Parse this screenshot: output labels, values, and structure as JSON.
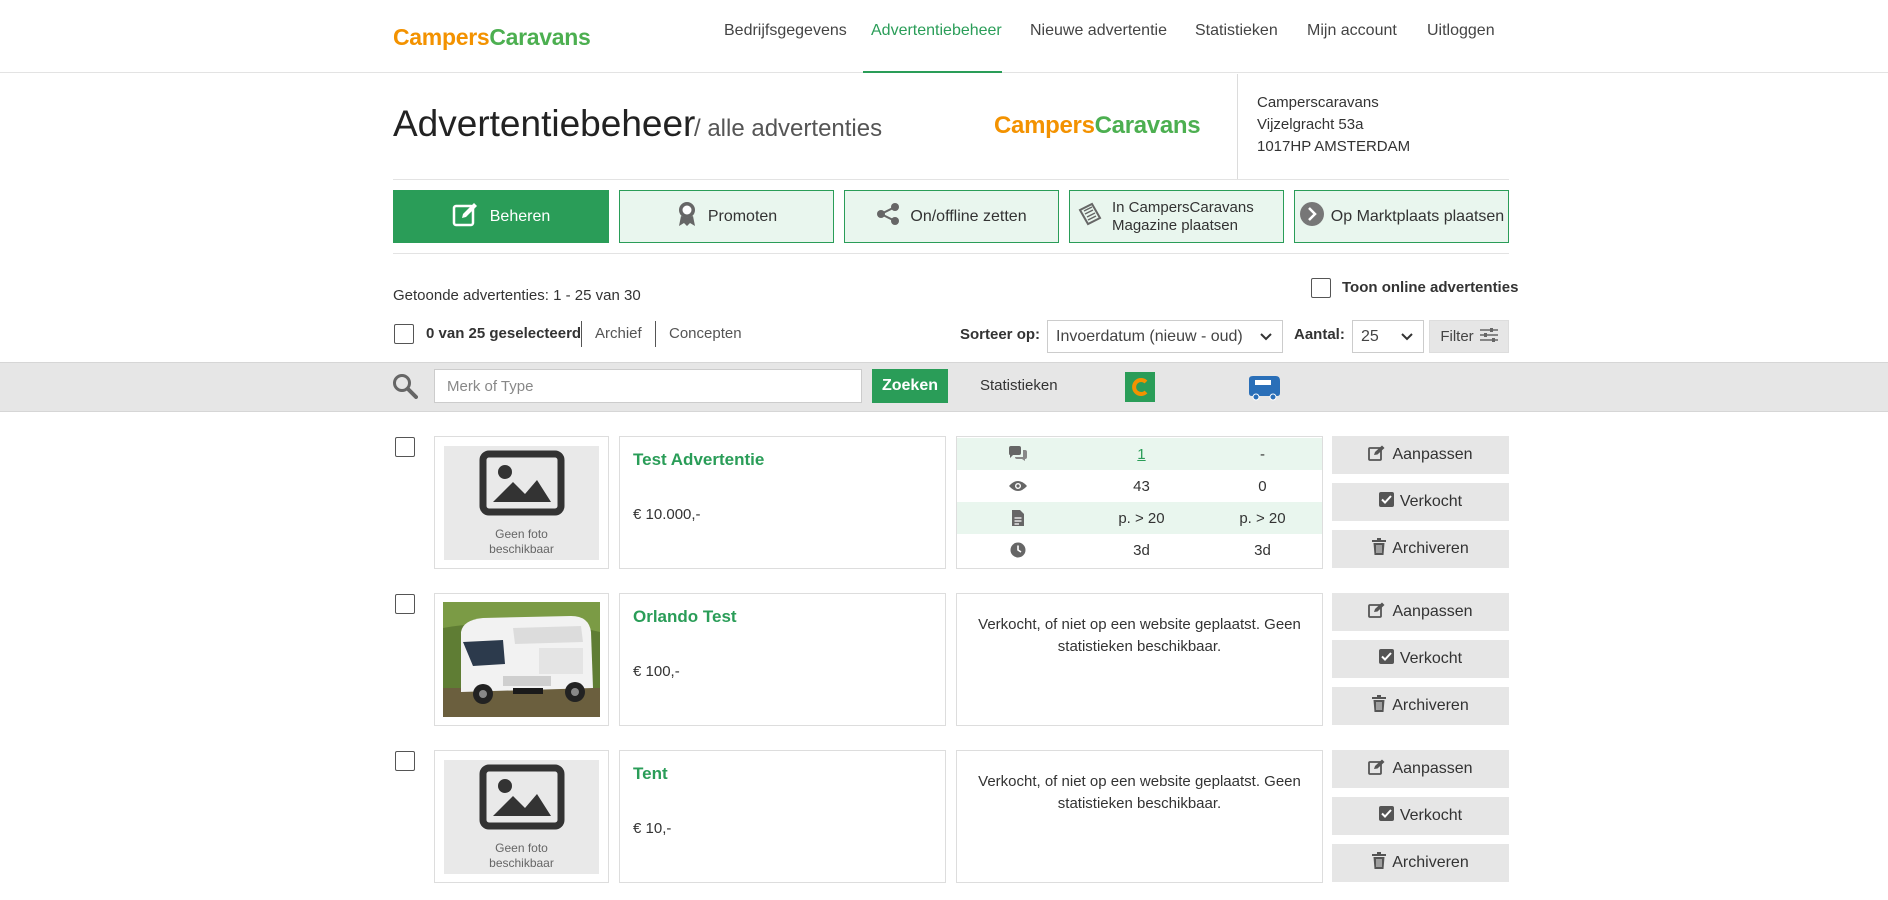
{
  "brand": {
    "part1": "Campers",
    "part2": "Caravans"
  },
  "nav": {
    "items": [
      {
        "label": "Bedrijfsgegevens"
      },
      {
        "label": "Advertentiebeheer"
      },
      {
        "label": "Nieuwe advertentie"
      },
      {
        "label": "Statistieken"
      },
      {
        "label": "Mijn account"
      },
      {
        "label": "Uitloggen"
      }
    ],
    "active_index": 1
  },
  "page": {
    "title": "Advertentiebeheer",
    "subtitle": "/ alle advertenties"
  },
  "company": {
    "name": "Camperscaravans",
    "street": "Vijzelgracht 53a",
    "city": "1017HP AMSTERDAM"
  },
  "actions": [
    {
      "label": "Beheren",
      "icon": "edit-icon"
    },
    {
      "label": "Promoten",
      "icon": "award-icon"
    },
    {
      "label": "On/offline zetten",
      "icon": "share-icon"
    },
    {
      "label_line1": "In CampersCaravans",
      "label_line2": "Magazine plaatsen",
      "icon": "magazine-icon"
    },
    {
      "label": "Op Marktplaats plaatsen",
      "icon": "marktplaats-icon"
    }
  ],
  "listing_info": {
    "shown": "Getoonde advertenties: 1 - 25 van 30",
    "selected": "0 van 25 geselecteerd",
    "archive": "Archief",
    "concepts": "Concepten",
    "show_online": "Toon online advertenties"
  },
  "sort": {
    "label": "Sorteer op:",
    "value": "Invoerdatum (nieuw - oud)"
  },
  "count": {
    "label": "Aantal:",
    "value": "25"
  },
  "filter_label": "Filter",
  "search": {
    "placeholder": "Merk of Type",
    "button": "Zoeken",
    "stats_label": "Statistieken"
  },
  "no_photo": {
    "line1": "Geen foto",
    "line2": "beschikbaar"
  },
  "row_buttons": {
    "edit": "Aanpassen",
    "sold": "Verkocht",
    "archive": "Archiveren"
  },
  "listings": [
    {
      "title": "Test Advertentie",
      "price": "€ 10.000,-",
      "has_photo": false,
      "stats": {
        "messages": [
          "1",
          "-"
        ],
        "views": [
          "43",
          "0"
        ],
        "page": [
          "p. > 20",
          "p. > 20"
        ],
        "time": [
          "3d",
          "3d"
        ]
      }
    },
    {
      "title": "Orlando Test",
      "price": "€ 100,-",
      "has_photo": true,
      "no_stats": {
        "line1": "Verkocht, of niet op een website geplaatst. Geen",
        "line2": "statistieken beschikbaar."
      }
    },
    {
      "title": "Tent",
      "price": "€ 10,-",
      "has_photo": false,
      "no_stats": {
        "line1": "Verkocht, of niet op een website geplaatst. Geen",
        "line2": "statistieken beschikbaar."
      }
    }
  ],
  "colors": {
    "green": "#2a9d58",
    "orange": "#f39200",
    "light_green": "#e9f6ee",
    "grey_bar": "#e6e6e6"
  }
}
